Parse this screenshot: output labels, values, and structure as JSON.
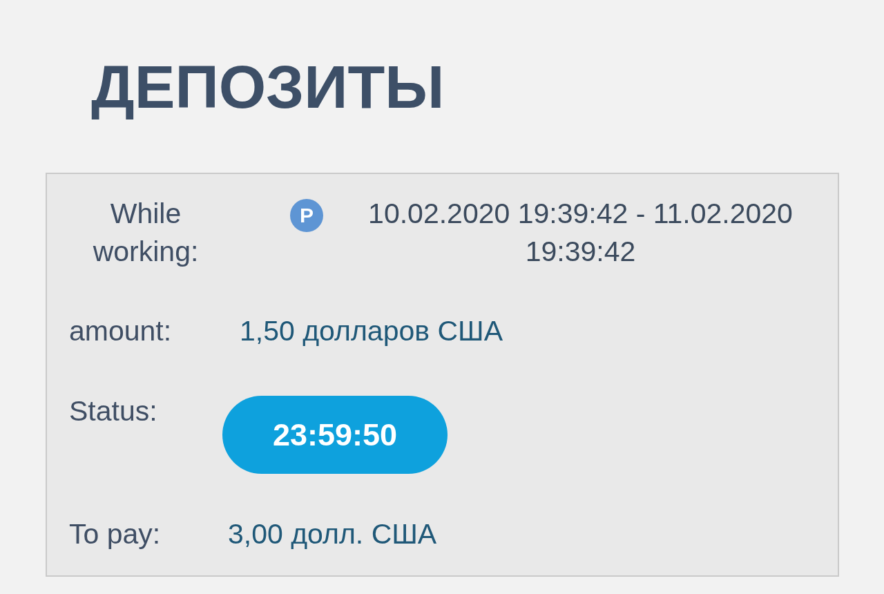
{
  "page_title": "ДЕПОЗИТЫ",
  "deposit": {
    "period": {
      "label": "While working:",
      "payment_badge": "P",
      "date_range": "10.02.2020 19:39:42 - 11.02.2020 19:39:42"
    },
    "amount": {
      "label": "amount:",
      "value": "1,50 долларов США"
    },
    "status": {
      "label": "Status:",
      "timer": "23:59:50"
    },
    "to_pay": {
      "label": "To pay:",
      "value": "3,00 долл. США"
    }
  }
}
